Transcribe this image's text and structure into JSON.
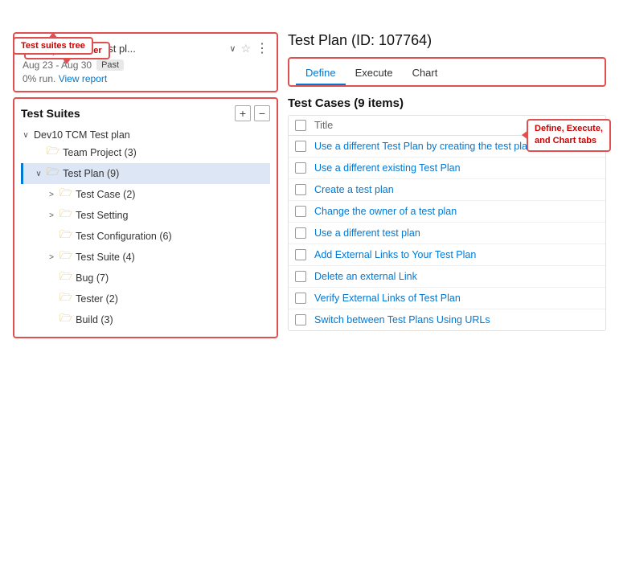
{
  "annotations": {
    "test_plan_header_label": "Test plan header",
    "test_suites_tree_label": "Test suites tree",
    "define_execute_chart_label": "Define, Execute,\nand Chart tabs"
  },
  "left": {
    "header": {
      "title": "Dev10 TCM Test pl...",
      "date_range": "Aug 23 - Aug 30",
      "past_badge": "Past",
      "run_percent": "0% run.",
      "view_report_link": "View report"
    },
    "suites": {
      "title": "Test Suites",
      "add_btn": "+",
      "collapse_btn": "−",
      "tree": [
        {
          "indent": 1,
          "expand": "∨",
          "has_folder": false,
          "label": "Dev10 TCM Test plan"
        },
        {
          "indent": 2,
          "expand": " ",
          "has_folder": true,
          "label": "Team Project (3)"
        },
        {
          "indent": 2,
          "expand": "∨",
          "has_folder": true,
          "label": "Test Plan (9)",
          "selected": true
        },
        {
          "indent": 3,
          "expand": ">",
          "has_folder": true,
          "label": "Test Case (2)"
        },
        {
          "indent": 3,
          "expand": ">",
          "has_folder": true,
          "label": "Test Setting"
        },
        {
          "indent": 3,
          "expand": " ",
          "has_folder": true,
          "label": "Test Configuration (6)"
        },
        {
          "indent": 3,
          "expand": ">",
          "has_folder": true,
          "label": "Test Suite (4)"
        },
        {
          "indent": 3,
          "expand": " ",
          "has_folder": true,
          "label": "Bug (7)"
        },
        {
          "indent": 3,
          "expand": " ",
          "has_folder": true,
          "label": "Tester (2)"
        },
        {
          "indent": 3,
          "expand": " ",
          "has_folder": true,
          "label": "Build (3)"
        }
      ]
    }
  },
  "right": {
    "plan_title": "Test Plan (ID: 107764)",
    "tabs": [
      {
        "label": "Define",
        "active": true
      },
      {
        "label": "Execute",
        "active": false
      },
      {
        "label": "Chart",
        "active": false
      }
    ],
    "test_cases_heading": "Test Cases (9 items)",
    "test_cases_col_title": "Title",
    "test_cases": [
      {
        "label": "Use a different Test Plan by creating the test plan"
      },
      {
        "label": "Use a different existing Test Plan"
      },
      {
        "label": "Create a test plan"
      },
      {
        "label": "Change the owner of a test plan"
      },
      {
        "label": "Use a different test plan"
      },
      {
        "label": "Add External Links to Your Test Plan"
      },
      {
        "label": "Delete an external Link"
      },
      {
        "label": "Verify External Links of Test Plan"
      },
      {
        "label": "Switch between Test Plans Using URLs"
      }
    ]
  }
}
